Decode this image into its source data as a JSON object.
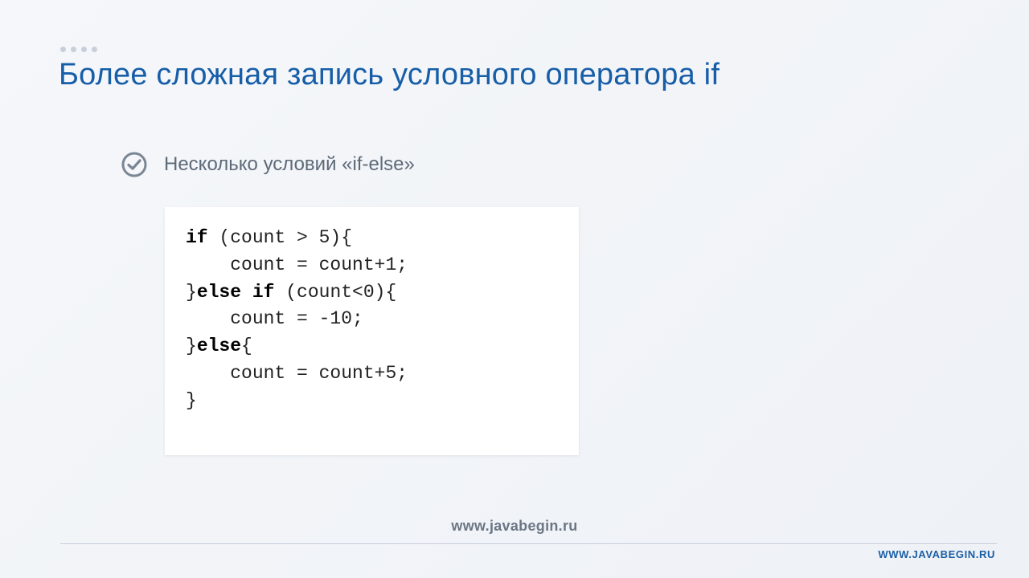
{
  "title": "Более сложная запись условного оператора if",
  "section_heading": "Несколько условий «if-else»",
  "code": {
    "l1a": "if",
    "l1b": " (count > 5){",
    "l2": "    count = count+1;",
    "l3a": "}",
    "l3b": "else if",
    "l3c": " (count<0){",
    "l4": "    count = -10;",
    "l5a": "}",
    "l5b": "else",
    "l5c": "{",
    "l6": "    count = count+5;",
    "l7": "}"
  },
  "footer_center": "www.javabegin.ru",
  "footer_right": "WWW.JAVABEGIN.RU"
}
